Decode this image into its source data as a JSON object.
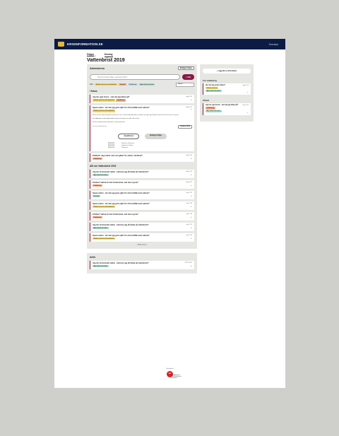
{
  "header": {
    "brand": "KRISINFORMATION.SE",
    "lang": "Svenska"
  },
  "breadcrumb": {
    "item1": "Frågor",
    "item1_sub": "Skicka fråga",
    "item2": "Ämning"
  },
  "page_title": "Vattenbrist 2019",
  "admin": {
    "title": "Administrera",
    "edit_button": "Redigera frågor",
    "search_placeholder": "Sök på ord eller fråga i vattenbrist 2019",
    "search_button": "Sök",
    "filter_label": "Filter",
    "filters": [
      "Mindre om krav vid vattenbrist",
      "Kontroll",
      "Dubblering",
      "Äga status att verka"
    ],
    "sort_label": "Nyaste"
  },
  "fokus": {
    "title": "I fokus",
    "items": [
      {
        "title": "Jag har eget brunn - vad ska jag tänka på?",
        "date": "idag kl 14",
        "tags": [
          "Mindre om krav vid vattenbrist",
          "Dubblering"
        ]
      },
      {
        "title": "Spara vatten - hur kan jag göra själv för att hushålla med vattnet?",
        "date": "idag kl 12",
        "tags": [
          "Mindre om krav vid vattenbrist"
        ],
        "body": [
          "Ni för vara att raka tid mycket vatten än ni tror. Tänk kvadratiskt bilar se tomhet och gör upp till plats som om bra till är att ta en spara.",
          "Om tillgången under tidsperioden kommer att spara av vatten blir ett bra.",
          "Se för att skapa ökat information i kommunal länk."
        ],
        "source": "Läs mer källa kommun",
        "copy_link": "Kopiera länk",
        "publish_button": "Avpublicera",
        "edit_button": "Redigera fråga",
        "log": [
          {
            "date": "2019-06-21",
            "text": "Skapad av kommunen"
          },
          {
            "date": "2019-06-25",
            "text": "Uppdaterad av Anna"
          },
          {
            "date": "2019-07-01",
            "text": "Publicerad"
          }
        ]
      },
      {
        "title": "Dubblett: Jag undrar vad som gäller för vatten i lantbruk?",
        "date": "idag kl 10",
        "tags": [
          "Dubblering"
        ]
      }
    ]
  },
  "all": {
    "title": "Allt om Vattenbrist 2019",
    "items": [
      {
        "title": "Jag har kommunalt vatten - behöver jag då tänka på vattenbrist?",
        "date": "idag kl 10",
        "tags": [
          "Äga status att verka"
        ]
      },
      {
        "title": "Kokbart: Vattnet är kan förekomma, vad ska vi göra?",
        "date": "idag kl 09",
        "tags": [
          "Dubblering"
        ]
      },
      {
        "title": "Spara vatten - hur kan jag göra själv för att hushålla med vattnet?",
        "date": "igår kl 19",
        "tags": [
          "Kontroll"
        ]
      },
      {
        "title": "Spara vatten - hur kan jag göra själv för att hushålla med vattnet?",
        "date": "igår kl 18",
        "tags": [
          "Mindre om krav vid vattenbrist"
        ]
      },
      {
        "title": "Kokbart: Vattnet är kan förekomma, vad ska vi göra?",
        "date": "igår kl 16",
        "tags": [
          "Dubblering"
        ]
      },
      {
        "title": "Jag har kommunalt vatten - behöver jag då tänka på vattenbrist?",
        "date": "igår kl 14",
        "tags": [
          "Äga status att verka"
        ]
      },
      {
        "title": "Spara vatten - hur kan jag göra själv för att hushålla med vattnet?",
        "date": "igår kl 10",
        "tags": [
          "Mindre om krav vid vattenbrist"
        ]
      }
    ],
    "pager": "Sida 1 av 4"
  },
  "arkiv": {
    "title": "Arkiv",
    "items": [
      {
        "title": "Jag har kommunalt vatten - behöver jag då tänka på vattenbrist?",
        "date": "2019-05-02",
        "tags": [
          "Äga status att verka"
        ]
      }
    ]
  },
  "side": {
    "add_button": "+ Lägg till ny information",
    "validation_title": "För validering",
    "validation_item": {
      "title": "Hur kan jag spara vatten?",
      "date": "idag kl 14",
      "tags": [
        "Mindre om krav",
        "Äga status att verka"
      ]
    },
    "answered_title": "Utkast",
    "answered_item": {
      "title": "Jag har eget brunn - vad ska jag tänka på?",
      "date": "idag kl 11",
      "tags": [
        "Dubblering",
        "Äga status att verka"
      ]
    }
  },
  "footer": {
    "text": "Utvecklad av",
    "agency": "Myndigheten för samhällsskydd och beredskap",
    "seal": "MSB"
  },
  "colors": {
    "navy": "#0b1b44",
    "accent": "#8a1846",
    "yellow": "#f3d35a",
    "orange": "#f3a979",
    "green": "#9fd9c6"
  }
}
